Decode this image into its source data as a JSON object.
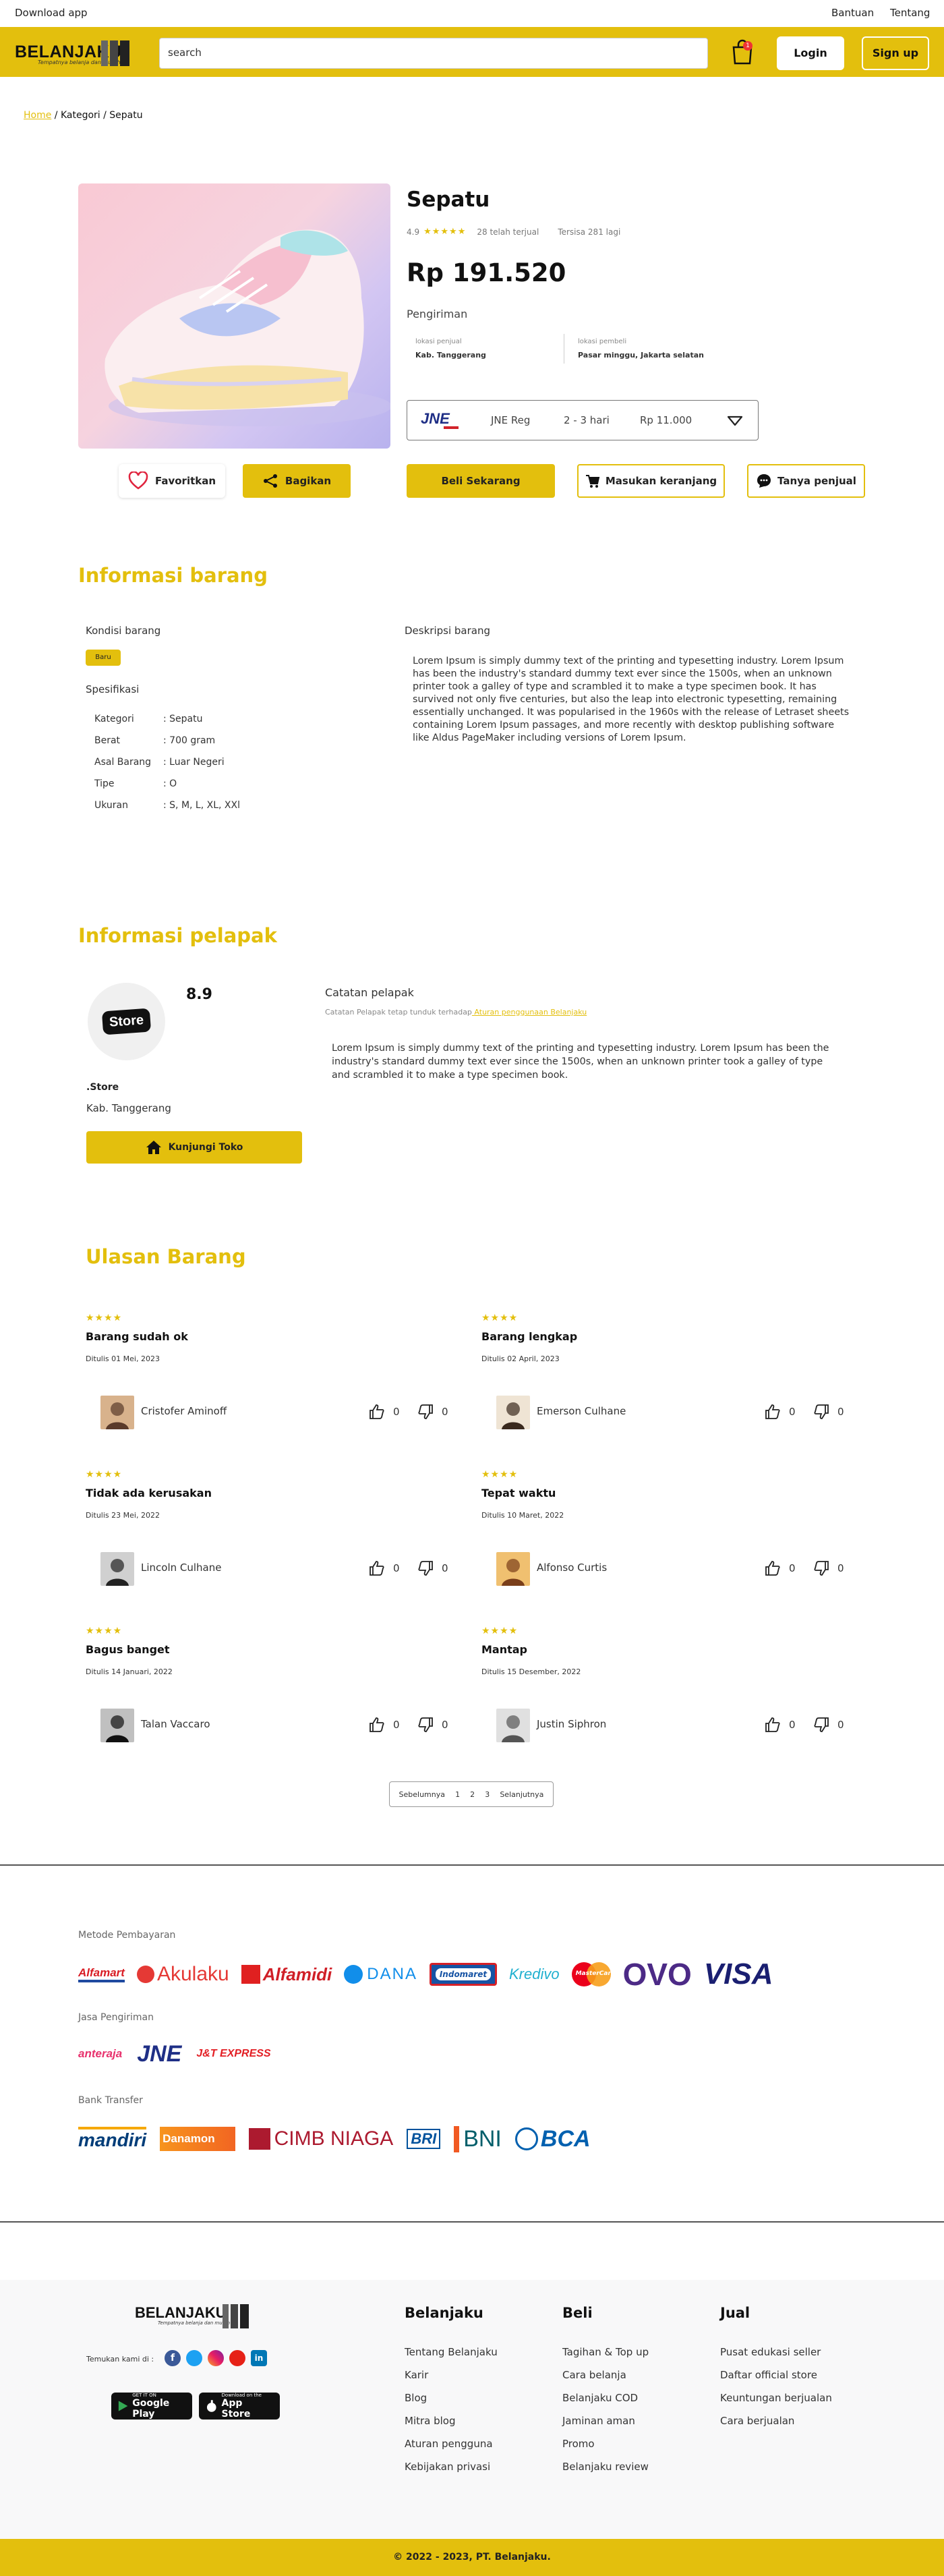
{
  "topbar": {
    "download": "Download app",
    "help": "Bantuan",
    "about": "Tentang"
  },
  "header": {
    "logo": "BELANJAKU",
    "tagline": "Tempatnya belanja dan murah",
    "search_value": "search",
    "cart_count": "1",
    "login": "Login",
    "signup": "Sign up"
  },
  "breadcrumb": {
    "home": "Home",
    "rest": " / Kategori / Sepatu"
  },
  "product": {
    "title": "Sepatu",
    "rating": "4.9",
    "stars": "★★★★★",
    "sold": "28 telah terjual",
    "stock": "Tersisa 281 lagi",
    "price": "Rp 191.520",
    "shipping_label": "Pengiriman",
    "seller_loc_label": "lokasi penjual",
    "seller_loc": "Kab. Tanggerang",
    "buyer_loc_label": "lokasi pembeli",
    "buyer_loc": "Pasar minggu, Jakarta selatan",
    "courier_logo": "JNE",
    "courier_service": "JNE Reg",
    "courier_days": "2 - 3 hari",
    "courier_cost": "Rp 11.000"
  },
  "actions": {
    "favorite": "Favoritkan",
    "share": "Bagikan",
    "buy": "Beli Sekarang",
    "add_cart": "Masukan keranjang",
    "ask": "Tanya penjual"
  },
  "item_info": {
    "title": "Informasi barang",
    "condition_label": "Kondisi barang",
    "condition": "Baru",
    "spec_label": "Spesifikasi",
    "specs": [
      {
        "k": "Kategori",
        "v": ": Sepatu"
      },
      {
        "k": "Berat",
        "v": ": 700 gram"
      },
      {
        "k": "Asal Barang",
        "v": ": Luar Negeri"
      },
      {
        "k": "Tipe",
        "v": ": O"
      },
      {
        "k": "Ukuran",
        "v": ": S, M, L, XL, XXl"
      }
    ],
    "desc_label": "Deskripsi barang",
    "desc": "Lorem Ipsum is simply dummy text of the printing and typesetting industry. Lorem Ipsum has been the industry's standard dummy text ever since the 1500s, when an unknown printer took a galley of type and scrambled it to make a type specimen book. It has survived not only five centuries, but also the leap into electronic typesetting, remaining essentially unchanged. It was popularised in the 1960s with the release of Letraset sheets containing Lorem Ipsum passages, and more recently with desktop publishing software like Aldus PageMaker including versions of Lorem Ipsum."
  },
  "seller": {
    "title": "Informasi pelapak",
    "logo_text": "Store",
    "score": "8.9",
    "name": ".Store",
    "city": "Kab. Tanggerang",
    "visit": "Kunjungi Toko",
    "note_title": "Catatan pelapak",
    "note_sub": "Catatan Pelapak tetap tunduk terhadap",
    "note_link": " Aturan penggunaan Belanjaku",
    "note_text": "Lorem Ipsum is simply dummy text of the printing and typesetting industry. Lorem Ipsum has been the industry's standard dummy text ever since the 1500s, when an unknown printer took a galley of type and scrambled it to make a type specimen book."
  },
  "reviews": {
    "title": "Ulasan Barang",
    "items": [
      {
        "stars": "★★★★",
        "title": "Barang sudah ok",
        "date": "Ditulis 01 Mei, 2023",
        "name": "Cristofer Aminoff",
        "up": "0",
        "down": "0"
      },
      {
        "stars": "★★★★",
        "title": "Barang lengkap",
        "date": "Ditulis 02 April, 2023",
        "name": "Emerson Culhane",
        "up": "0",
        "down": "0"
      },
      {
        "stars": "★★★★",
        "title": "Tidak ada kerusakan",
        "date": "Ditulis 23 Mei, 2022",
        "name": "Lincoln Culhane",
        "up": "0",
        "down": "0"
      },
      {
        "stars": "★★★★",
        "title": "Tepat waktu",
        "date": "Ditulis 10 Maret, 2022",
        "name": "Alfonso Curtis",
        "up": "0",
        "down": "0"
      },
      {
        "stars": "★★★★",
        "title": "Bagus banget",
        "date": "Ditulis 14 Januari, 2022",
        "name": "Talan Vaccaro",
        "up": "0",
        "down": "0"
      },
      {
        "stars": "★★★★",
        "title": "Mantap",
        "date": "Ditulis 15 Desember, 2022",
        "name": "Justin Siphron",
        "up": "0",
        "down": "0"
      }
    ],
    "pager": {
      "prev": "Sebelumnya",
      "p1": "1",
      "p2": "2",
      "p3": "3",
      "next": "Selanjutnya"
    }
  },
  "payments": {
    "method_label": "Metode Pembayaran",
    "methods": [
      "Alfamart",
      "Akulaku",
      "Alfamidi",
      "DANA",
      "Indomaret",
      "Kredivo",
      "MasterCard",
      "OVO",
      "VISA"
    ],
    "shipping_label": "Jasa Pengiriman",
    "couriers": [
      "anteraja",
      "JNE",
      "J&T EXPRESS"
    ],
    "bank_label": "Bank Transfer",
    "banks": [
      "mandiri",
      "Danamon",
      "CIMB NIAGA",
      "BRI",
      "BNI",
      "BCA"
    ]
  },
  "footer": {
    "logo": "BELANJAKU",
    "tagline": "Tempatnya belanja dan murah",
    "find_us": "Temukan kami di :",
    "gplay_small": "GET IT ON",
    "gplay": "Google Play",
    "appstore_small": "Download on the",
    "appstore": "App Store",
    "col1_title": "Belanjaku",
    "col1": [
      "Tentang Belanjaku",
      "Karir",
      "Blog",
      "Mitra blog",
      "Aturan pengguna",
      "Kebijakan privasi"
    ],
    "col2_title": "Beli",
    "col2": [
      "Tagihan & Top up",
      "Cara belanja",
      "Belanjaku COD",
      "Jaminan aman",
      "Promo",
      "Belanjaku review"
    ],
    "col3_title": "Jual",
    "col3": [
      "Pusat edukasi seller",
      "Daftar official store",
      "Keuntungan berjualan",
      "Cara berjualan"
    ],
    "copyright": "© 2022 - 2023, PT. Belanjaku."
  },
  "colors": {
    "accent": "#e3bf0d"
  }
}
